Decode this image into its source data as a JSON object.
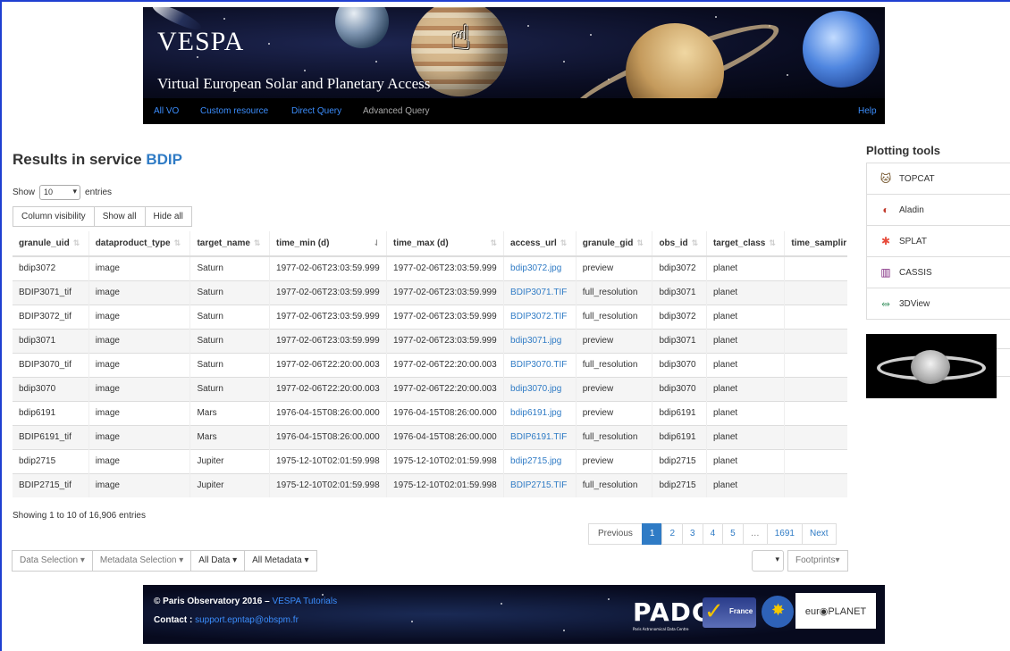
{
  "banner": {
    "brand": "VESPA",
    "subtitle": "Virtual European Solar and Planetary Access"
  },
  "nav": {
    "items": [
      {
        "label": "All VO"
      },
      {
        "label": "Custom resource"
      },
      {
        "label": "Direct Query"
      },
      {
        "label": "Advanced Query"
      },
      {
        "label": "Help"
      }
    ]
  },
  "results": {
    "title_prefix": "Results in service",
    "service": "BDIP",
    "show_label": "Show",
    "entries_value": "10",
    "entries_label": "entries"
  },
  "table_buttons": {
    "column_visibility": "Column visibility",
    "show_all": "Show all",
    "hide_all": "Hide all"
  },
  "table": {
    "columns": [
      "granule_uid",
      "dataproduct_type",
      "target_name",
      "time_min (d)",
      "time_max (d)",
      "access_url",
      "granule_gid",
      "obs_id",
      "target_class",
      "time_samplir"
    ],
    "rows": [
      [
        "bdip3072",
        "image",
        "Saturn",
        "1977-02-06T23:03:59.999",
        "1977-02-06T23:03:59.999",
        "bdip3072.jpg",
        "preview",
        "bdip3072",
        "planet",
        ""
      ],
      [
        "BDIP3071_tif",
        "image",
        "Saturn",
        "1977-02-06T23:03:59.999",
        "1977-02-06T23:03:59.999",
        "BDIP3071.TIF",
        "full_resolution",
        "bdip3071",
        "planet",
        ""
      ],
      [
        "BDIP3072_tif",
        "image",
        "Saturn",
        "1977-02-06T23:03:59.999",
        "1977-02-06T23:03:59.999",
        "BDIP3072.TIF",
        "full_resolution",
        "bdip3072",
        "planet",
        ""
      ],
      [
        "bdip3071",
        "image",
        "Saturn",
        "1977-02-06T23:03:59.999",
        "1977-02-06T23:03:59.999",
        "bdip3071.jpg",
        "preview",
        "bdip3071",
        "planet",
        ""
      ],
      [
        "BDIP3070_tif",
        "image",
        "Saturn",
        "1977-02-06T22:20:00.003",
        "1977-02-06T22:20:00.003",
        "BDIP3070.TIF",
        "full_resolution",
        "bdip3070",
        "planet",
        ""
      ],
      [
        "bdip3070",
        "image",
        "Saturn",
        "1977-02-06T22:20:00.003",
        "1977-02-06T22:20:00.003",
        "bdip3070.jpg",
        "preview",
        "bdip3070",
        "planet",
        ""
      ],
      [
        "bdip6191",
        "image",
        "Mars",
        "1976-04-15T08:26:00.000",
        "1976-04-15T08:26:00.000",
        "bdip6191.jpg",
        "preview",
        "bdip6191",
        "planet",
        ""
      ],
      [
        "BDIP6191_tif",
        "image",
        "Mars",
        "1976-04-15T08:26:00.000",
        "1976-04-15T08:26:00.000",
        "BDIP6191.TIF",
        "full_resolution",
        "bdip6191",
        "planet",
        ""
      ],
      [
        "bdip2715",
        "image",
        "Jupiter",
        "1975-12-10T02:01:59.998",
        "1975-12-10T02:01:59.998",
        "bdip2715.jpg",
        "preview",
        "bdip2715",
        "planet",
        ""
      ],
      [
        "BDIP2715_tif",
        "image",
        "Jupiter",
        "1975-12-10T02:01:59.998",
        "1975-12-10T02:01:59.998",
        "BDIP2715.TIF",
        "full_resolution",
        "bdip2715",
        "planet",
        ""
      ]
    ]
  },
  "info": "Showing 1 to 10 of 16,906 entries",
  "pager": {
    "previous": "Previous",
    "pages": [
      "1",
      "2",
      "3",
      "4",
      "5",
      "…",
      "1691"
    ],
    "next": "Next"
  },
  "bottom": {
    "data_selection": "Data Selection",
    "metadata_selection": "Metadata Selection",
    "all_data": "All Data",
    "all_metadata": "All Metadata",
    "footprints": "Footprints"
  },
  "footer": {
    "copyright": "© Paris Observatory 2016 –",
    "tutorials": "VESPA Tutorials",
    "contact_label": "Contact :",
    "contact_email": "support.epntap@obspm.fr",
    "padc": "PADC",
    "padc_sub": "Paris Astronomical Data Centre",
    "france": "France",
    "europlanet": "eur◉PLANET"
  },
  "sidebar": {
    "title": "Plotting tools",
    "tools": [
      {
        "label": "TOPCAT",
        "icon": "topcat-icon"
      },
      {
        "label": "Aladin",
        "icon": "aladin-icon"
      },
      {
        "label": "SPLAT",
        "icon": "splat-icon"
      },
      {
        "label": "CASSIS",
        "icon": "cassis-icon"
      },
      {
        "label": "3DView",
        "icon": "3dview-icon"
      }
    ]
  },
  "colors": {
    "accent": "#2f7bc5",
    "nav_link": "#3b8dfc",
    "frame": "#1f3fd1"
  }
}
